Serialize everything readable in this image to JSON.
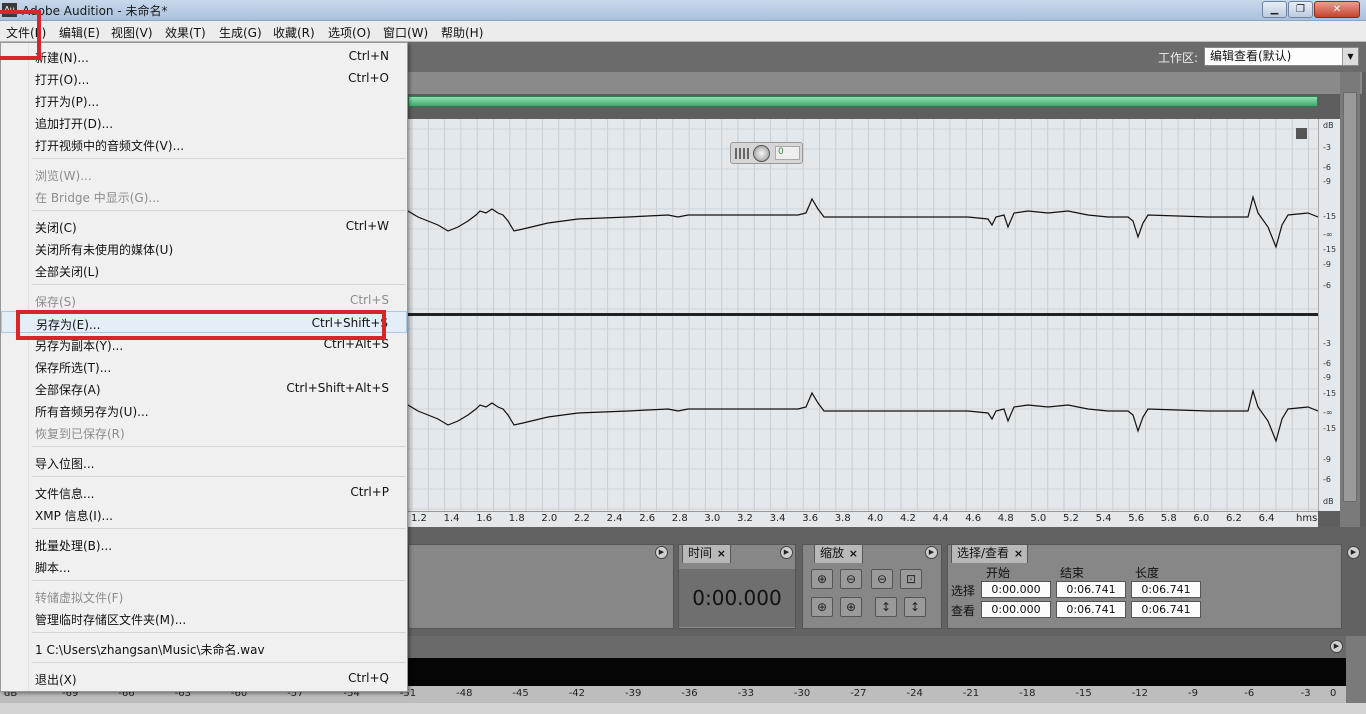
{
  "window": {
    "title": "Adobe Audition - 未命名*",
    "app_icon_text": "Au",
    "min_label": "▁",
    "max_label": "❐",
    "close_label": "✕"
  },
  "menubar": [
    "文件(F)",
    "编辑(E)",
    "视图(V)",
    "效果(T)",
    "生成(G)",
    "收藏(R)",
    "选项(O)",
    "窗口(W)",
    "帮助(H)"
  ],
  "workspace": {
    "label": "工作区:",
    "selected": "编辑查看(默认)"
  },
  "file_menu": {
    "items": [
      {
        "label": "新建(N)...",
        "shortcut": "Ctrl+N",
        "enabled": true
      },
      {
        "label": "打开(O)...",
        "shortcut": "Ctrl+O",
        "enabled": true
      },
      {
        "label": "打开为(P)...",
        "shortcut": "",
        "enabled": true
      },
      {
        "label": "追加打开(D)...",
        "shortcut": "",
        "enabled": true
      },
      {
        "label": "打开视频中的音频文件(V)...",
        "shortcut": "",
        "enabled": true
      },
      {
        "label": "浏览(W)...",
        "shortcut": "",
        "enabled": false
      },
      {
        "label": "在 Bridge 中显示(G)...",
        "shortcut": "",
        "enabled": false
      },
      {
        "label": "关闭(C)",
        "shortcut": "Ctrl+W",
        "enabled": true
      },
      {
        "label": "关闭所有未使用的媒体(U)",
        "shortcut": "",
        "enabled": true
      },
      {
        "label": "全部关闭(L)",
        "shortcut": "",
        "enabled": true
      },
      {
        "label": "保存(S)",
        "shortcut": "Ctrl+S",
        "enabled": false
      },
      {
        "label": "另存为(E)...",
        "shortcut": "Ctrl+Shift+S",
        "enabled": true,
        "hover": true
      },
      {
        "label": "另存为副本(Y)...",
        "shortcut": "Ctrl+Alt+S",
        "enabled": true
      },
      {
        "label": "保存所选(T)...",
        "shortcut": "",
        "enabled": true
      },
      {
        "label": "全部保存(A)",
        "shortcut": "Ctrl+Shift+Alt+S",
        "enabled": true
      },
      {
        "label": "所有音频另存为(U)...",
        "shortcut": "",
        "enabled": true
      },
      {
        "label": "恢复到已保存(R)",
        "shortcut": "",
        "enabled": false
      },
      {
        "label": "导入位图...",
        "shortcut": "",
        "enabled": true
      },
      {
        "label": "文件信息...",
        "shortcut": "Ctrl+P",
        "enabled": true
      },
      {
        "label": "XMP 信息(I)...",
        "shortcut": "",
        "enabled": true
      },
      {
        "label": "批量处理(B)...",
        "shortcut": "",
        "enabled": true
      },
      {
        "label": "脚本...",
        "shortcut": "",
        "enabled": true
      },
      {
        "label": "转储虚拟文件(F)",
        "shortcut": "",
        "enabled": false
      },
      {
        "label": "管理临时存储区文件夹(M)...",
        "shortcut": "",
        "enabled": true
      },
      {
        "label": "1 C:\\Users\\zhangsan\\Music\\未命名.wav",
        "shortcut": "",
        "enabled": true
      },
      {
        "label": "退出(X)",
        "shortcut": "Ctrl+Q",
        "enabled": true
      }
    ]
  },
  "waveform": {
    "db_labels_top": [
      "dB",
      "-3",
      "-6",
      "-9",
      "-15",
      "-∞",
      "-15",
      "-9",
      "-6",
      "-3"
    ],
    "db_labels_bottom": [
      "-3",
      "-6",
      "-9",
      "-15",
      "-∞",
      "-15",
      "-9",
      "-6",
      "dB"
    ],
    "time_labels": [
      "1.2",
      "1.4",
      "1.6",
      "1.8",
      "2.0",
      "2.2",
      "2.4",
      "2.6",
      "2.8",
      "3.0",
      "3.2",
      "3.4",
      "3.6",
      "3.8",
      "4.0",
      "4.2",
      "4.4",
      "4.6",
      "4.8",
      "5.0",
      "5.2",
      "5.4",
      "5.6",
      "5.8",
      "6.0",
      "6.2",
      "6.4"
    ],
    "time_unit": "hms",
    "gain_value": "0"
  },
  "panels": {
    "time": {
      "tab": "时间",
      "value": "0:00.000"
    },
    "zoom": {
      "tab": "缩放"
    },
    "selection": {
      "tab": "选择/查看",
      "col_start": "开始",
      "col_end": "结束",
      "col_length": "长度",
      "row_select": "选择",
      "row_view": "查看",
      "select": {
        "start": "0:00.000",
        "end": "0:06.741",
        "length": "0:06.741"
      },
      "view": {
        "start": "0:00.000",
        "end": "0:06.741",
        "length": "0:06.741"
      }
    },
    "close_glyph": "×",
    "menu_glyph": "▶"
  },
  "meter": {
    "scale": [
      "dB",
      "-69",
      "-66",
      "-63",
      "-60",
      "-57",
      "-54",
      "-51",
      "-48",
      "-45",
      "-42",
      "-39",
      "-36",
      "-33",
      "-30",
      "-27",
      "-24",
      "-21",
      "-18",
      "-15",
      "-12",
      "-9",
      "-6",
      "-3",
      "0"
    ]
  },
  "colors": {
    "annotation": "#d6262b",
    "waveform": "#111111",
    "overview": "#3fa86c"
  }
}
